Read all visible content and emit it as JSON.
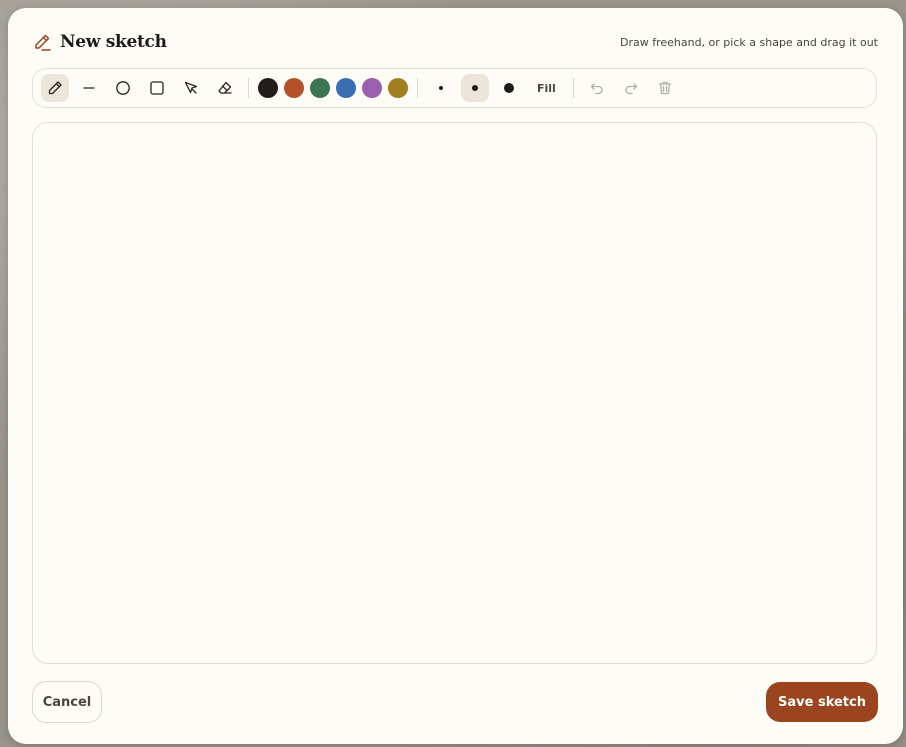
{
  "header": {
    "title": "New sketch",
    "hint": "Draw freehand, or pick a shape and drag it out"
  },
  "toolbar": {
    "tools": [
      {
        "name": "pen",
        "icon": "pencil-icon",
        "active": true
      },
      {
        "name": "line",
        "icon": "line-icon",
        "active": false
      },
      {
        "name": "circle",
        "icon": "circle-icon",
        "active": false
      },
      {
        "name": "rectangle",
        "icon": "square-icon",
        "active": false
      },
      {
        "name": "select",
        "icon": "pointer-icon",
        "active": false
      },
      {
        "name": "eraser",
        "icon": "eraser-icon",
        "active": false
      }
    ],
    "colors": [
      "#221c1a",
      "#b2512a",
      "#3a7452",
      "#3a6cb0",
      "#9b5fb0",
      "#a17e20"
    ],
    "sizes": [
      {
        "name": "small",
        "active": false
      },
      {
        "name": "medium",
        "active": true
      },
      {
        "name": "large",
        "active": false
      }
    ],
    "fill_label": "Fill",
    "actions": [
      "undo-icon",
      "redo-icon",
      "trash-icon"
    ]
  },
  "footer": {
    "cancel_label": "Cancel",
    "save_label": "Save sketch"
  },
  "theme": {
    "accent": "#9b4420",
    "background": "#fdfcf7"
  }
}
